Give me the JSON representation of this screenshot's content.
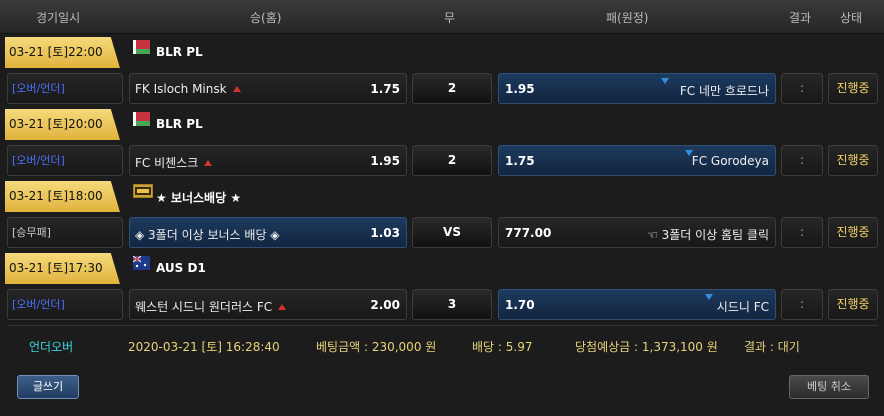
{
  "header": {
    "date": "경기일시",
    "home": "승(홈)",
    "draw": "무",
    "away": "패(원정)",
    "result": "결과",
    "status": "상태"
  },
  "sections": [
    {
      "datetime": "03-21 [토]22:00",
      "league": "BLR PL",
      "flag_icon": "belarus-flag-icon",
      "match": {
        "bet_type": "[오버/언더]",
        "home_team": "FK Isloch Minsk",
        "home_odds": "1.75",
        "draw": "2",
        "away_odds": "1.95",
        "away_team": "FC 네만 흐로드나",
        "result": ":",
        "status": "진행중",
        "selected": "away"
      }
    },
    {
      "datetime": "03-21 [토]20:00",
      "league": "BLR PL",
      "flag_icon": "belarus-flag-icon",
      "match": {
        "bet_type": "[오버/언더]",
        "home_team": "FC 비첸스크",
        "home_odds": "1.95",
        "draw": "2",
        "away_odds": "1.75",
        "away_team": "FC Gorodeya",
        "result": ":",
        "status": "진행중",
        "selected": "away"
      }
    },
    {
      "datetime": "03-21 [토]18:00",
      "league": "★ 보너스배당 ★",
      "flag_icon": "bonus-icon",
      "match": {
        "bet_type": "[승무패]",
        "home_team": "◈ 3폴더 이상 보너스 배당 ◈",
        "home_odds": "1.03",
        "draw": "VS",
        "away_odds": "777.00",
        "away_team": "☜ 3폴더 이상 홈팀 클릭",
        "result": ":",
        "status": "진행중",
        "selected": "home"
      }
    },
    {
      "datetime": "03-21 [토]17:30",
      "league": "AUS D1",
      "flag_icon": "australia-flag-icon",
      "match": {
        "bet_type": "[오버/언더]",
        "home_team": "웨스턴 시드니 원더러스 FC",
        "home_odds": "2.00",
        "draw": "3",
        "away_odds": "1.70",
        "away_team": "시드니 FC",
        "result": ":",
        "status": "진행중",
        "selected": "away"
      }
    }
  ],
  "summary": {
    "type": "언더오버",
    "datetime": "2020-03-21 [토] 16:28:40",
    "bet_amount": "베팅금액 : 230,000 원",
    "odds": "배당 : 5.97",
    "expected": "당첨예상금 : 1,373,100 원",
    "result": "결과 : 대기"
  },
  "buttons": {
    "write": "글쓰기",
    "cancel": "베팅 취소"
  },
  "colors": {
    "date_tag": "#e8c24f",
    "selected_bg": "#1d3a5e",
    "up_arrow": "#d0342c",
    "down_arrow": "#2f8fe0",
    "status": "#f2d16b"
  }
}
